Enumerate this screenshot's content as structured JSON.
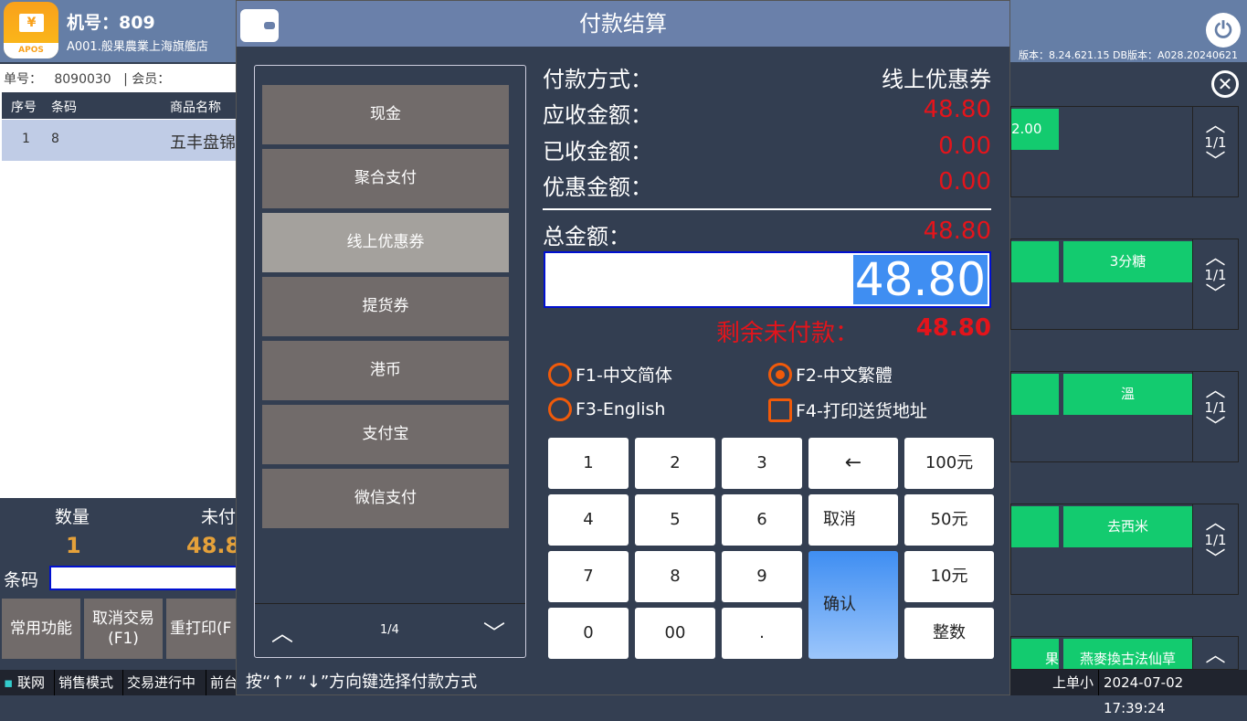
{
  "header": {
    "logo_text": "APOS",
    "logo_symbol": "¥",
    "terminal": "机号：809",
    "store": "A001.般果農業上海旗艦店",
    "version": "版本：8.24.621.15 DB版本：A028.20240621"
  },
  "order": {
    "label": "单号：",
    "number": "8090030",
    "member_label": "|  会员：",
    "columns": [
      "序号",
      "条码",
      "商品名称"
    ],
    "rows": [
      {
        "seq": "1",
        "barcode": "8",
        "name": "五丰盘锦"
      }
    ]
  },
  "stats": {
    "qty_label": "数量",
    "qty": "1",
    "unpaid_label": "未付",
    "unpaid": "48.8"
  },
  "barcode_label": "条码",
  "function_buttons": [
    "常用功能",
    "取消交易\n(F1)",
    "重打印(F"
  ],
  "statusbar": {
    "network": "联网",
    "mode": "销售模式",
    "state": "交易进行中",
    "front": "前台",
    "right_text": "上单小",
    "datetime": "2024-07-02 17:39:24"
  },
  "right_groups": [
    {
      "buttons": [
        "",
        "2.00"
      ],
      "page": "1/1"
    },
    {
      "buttons": [
        "",
        "3分糖"
      ],
      "page": "1/1"
    },
    {
      "buttons": [
        "",
        "溫"
      ],
      "page": "1/1"
    },
    {
      "buttons": [
        "",
        "去西米"
      ],
      "page": "1/1"
    },
    {
      "buttons": [
        "果",
        "燕麥換古法仙草"
      ],
      "page": ""
    }
  ],
  "dialog": {
    "title": "付款结算",
    "methods": [
      "现金",
      "聚合支付",
      "线上优惠券",
      "提货券",
      "港币",
      "支付宝",
      "微信支付"
    ],
    "selected_method": "线上优惠券",
    "methods_page": "1/4",
    "fields": [
      {
        "label": "付款方式：",
        "value": "线上优惠券"
      },
      {
        "label": "应收金额：",
        "value": "48.80"
      },
      {
        "label": "已收金额：",
        "value": "0.00"
      },
      {
        "label": "优惠金额：",
        "value": "0.00"
      }
    ],
    "total_label": "总金额：",
    "total": "48.80",
    "input_value": "48.80",
    "remain_label": "剩余未付款：",
    "remain": "48.80",
    "options": [
      {
        "label": "F1-中文简体",
        "type": "radio",
        "checked": false
      },
      {
        "label": "F2-中文繁體",
        "type": "radio",
        "checked": true
      },
      {
        "label": "F3-English",
        "type": "radio",
        "checked": false
      },
      {
        "label": "F4-打印送货地址",
        "type": "checkbox",
        "checked": false
      }
    ],
    "keys": [
      "1",
      "2",
      "3",
      "←",
      "100元",
      "4",
      "5",
      "6",
      "取消",
      "50元",
      "7",
      "8",
      "9",
      "10元",
      "0",
      "00",
      ".",
      "整数"
    ],
    "confirm": "确认",
    "hint": "按“↑”  “↓”方向键选择付款方式",
    "accent": "#e4141b"
  }
}
